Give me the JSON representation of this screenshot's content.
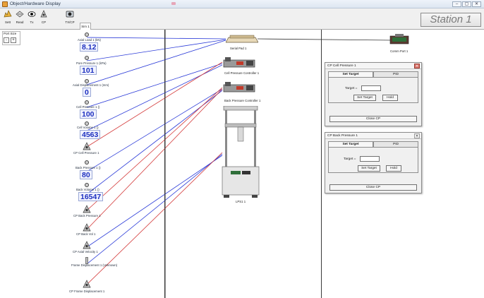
{
  "window": {
    "title": "Object/Hardware Display",
    "buttons": [
      "–",
      "▢",
      "✕"
    ]
  },
  "toolbar": {
    "buttons": [
      {
        "label": "Sett",
        "icon": "settings-icon"
      },
      {
        "label": "Read",
        "icon": "read-icon"
      },
      {
        "label": "Tx",
        "icon": "eye-icon"
      },
      {
        "label": "CP",
        "icon": "cp-icon"
      },
      {
        "label": "TX/CP",
        "icon": "tx-cp-icon"
      }
    ],
    "tab": "Sim 1",
    "station": "Station 1"
  },
  "port_size": {
    "label": "Port Size",
    "minus": "-",
    "plus": "+"
  },
  "sensors": [
    {
      "label": "Axial Load 1  (kN)",
      "value": "8.12"
    },
    {
      "label": "Pore Pressure 1  (kPa)",
      "value": "101"
    },
    {
      "label": "Axial Displacement 1  (mm)",
      "value": "0"
    },
    {
      "label": "Cell Pressure 1  ()",
      "value": "100"
    },
    {
      "label": "Cell Volume 1  ()",
      "value": "4563"
    },
    {
      "label": "Back Pressure 1  ()",
      "value": "80"
    },
    {
      "label": "Back Volume 1  ()",
      "value": "16547"
    }
  ],
  "controls": [
    "CP Cell Pressure 1",
    "CP Back Pressure 1",
    "CP Back Vol 1",
    "CP Axial Velocity 1",
    "Frame Displacement 1  (Unknown)",
    "CP Frame Displacement 1"
  ],
  "devices": [
    "Serial Pad 1",
    "Cell Pressure Controller 1",
    "Back Pressure Controller 1",
    "LPS1 1",
    "Comm Port 1"
  ],
  "dialogs": [
    {
      "title": "CP Cell Pressure 1",
      "close": "✕",
      "tabs": [
        "Set Target",
        "PID"
      ],
      "target_label": "Target =",
      "target_value": "",
      "set_button": "Set Target",
      "hold_button": "Hold",
      "close_button": "Close CP"
    },
    {
      "title": "CP Back Pressure 1",
      "close": "✕",
      "tabs": [
        "Set Target",
        "PID"
      ],
      "target_label": "Target =",
      "target_value": "",
      "set_button": "Set Target",
      "hold_button": "Hold",
      "close_button": "Close CP"
    }
  ],
  "colors": {
    "blue_link": "#2b3bd8",
    "red_link": "#d43a3a",
    "value_text": "#1c2fbf"
  }
}
